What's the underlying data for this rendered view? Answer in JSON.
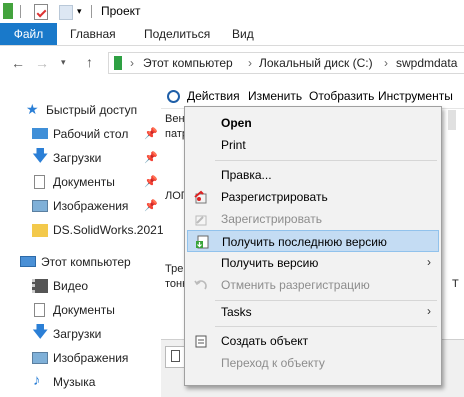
{
  "window": {
    "title": "Проект"
  },
  "ribbon": {
    "tabs": [
      "Файл",
      "Главная",
      "Поделиться",
      "Вид"
    ]
  },
  "address": {
    "segments": [
      "Этот компьютер",
      "Локальный диск (C:)",
      "swpdmdata"
    ]
  },
  "sidebar": {
    "quick_access": "Быстрый доступ",
    "quick_items": [
      "Рабочий стол",
      "Загрузки",
      "Документы",
      "Изображения",
      "DS.SolidWorks.2021"
    ],
    "this_pc": "Этот компьютер",
    "pc_items": [
      "Видео",
      "Документы",
      "Загрузки",
      "Изображения",
      "Музыка"
    ]
  },
  "pdm_toolbar": {
    "items": [
      "Действия",
      "Изменить",
      "Отобразить",
      "Инструменты"
    ]
  },
  "content": {
    "row1_a": "Вен",
    "row1_b": "патр",
    "row2": "ЛОГ",
    "row3_a": "Тре",
    "row3_b": "тонк",
    "right_mark": "Т"
  },
  "menu": {
    "open": "Open",
    "print": "Print",
    "edit": "Правка...",
    "register": "Разрегистрировать",
    "checkin": "Зарегистрировать",
    "get_latest": "Получить последнюю версию",
    "get_version": "Получить версию",
    "undo_checkout": "Отменить разрегистрацию",
    "tasks": "Tasks",
    "create_object": "Создать объект",
    "goto_object": "Переход к объекту"
  },
  "colors": {
    "file_tab": "#1979ca",
    "menu_highlight": "#c4dcf3",
    "folder_yellow": "#f3c94b"
  }
}
